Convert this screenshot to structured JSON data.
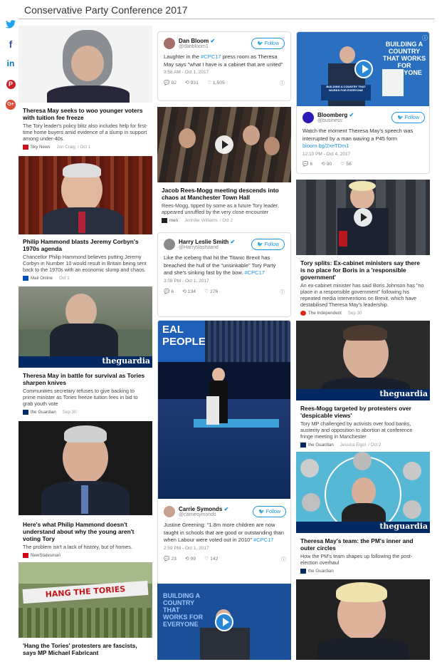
{
  "page": {
    "title": "Conservative Party Conference 2017"
  },
  "social": [
    {
      "name": "twitter",
      "glyph": "🐦"
    },
    {
      "name": "facebook",
      "glyph": "f"
    },
    {
      "name": "linkedin",
      "glyph": "in"
    },
    {
      "name": "pinterest",
      "glyph": "P"
    },
    {
      "name": "google-plus",
      "glyph": "G+"
    }
  ],
  "col1": [
    {
      "headline": "Theresa May seeks to woo younger voters with tuition fee freeze",
      "summary": "The Tory leader's policy blitz also includes help for first-time home buyers amid evidence of a slump in support among under-40s.",
      "source": "Sky News",
      "author": "Jon Craig",
      "date": "/ Oct 1"
    },
    {
      "headline": "Philip Hammond blasts Jeremy Corbyn's 1970s agenda",
      "summary": "Chancellor Philip Hammond believes putting Jeremy Corbyn in Number 10 would result in Britain being sent back to the 1970s with an economic slump and chaos.",
      "source": "Mail Online",
      "date": "Oct 1"
    },
    {
      "headline": "Theresa May in battle for survival as Tories sharpen knives",
      "summary": "Communities secretary refuses to give backing to prime minister as Tories freeze tuition fees in bid to grab youth vote",
      "source": "the Guardian",
      "date": "Sep 30"
    },
    {
      "headline": "Here's what Philip Hammond doesn't understand about why the young aren't voting Tory",
      "summary": "The problem isn't a lack of history, but of homes.",
      "source": "NewStatesman"
    },
    {
      "headline": "'Hang the Tories' protesters are fascists, says MP Michael Fabricant",
      "banner": "HANG THE TORIES"
    }
  ],
  "col2": {
    "tweet1": {
      "name": "Dan Bloom",
      "handle": "@danbloom1",
      "follow": "Follow",
      "text_pre": "Laughter in the ",
      "tag": "#CPC17",
      "text_post": " press room as Theresa May says \"what I have is a cabinet that are united\"",
      "time": "9:58 AM - Oct 1, 2017",
      "replies": "92",
      "retweets": "931",
      "likes": "1,505"
    },
    "article": {
      "headline": "Jacob Rees-Mogg meeting descends into chaos at Manchester Town Hall",
      "summary": "Rees-Mogg, tipped by some as a future Tory leader, appeared unruffled by the very close encounter",
      "source": "men",
      "author": "Jennifer Williams",
      "date": "/ Oct 2"
    },
    "tweet2": {
      "name": "Harry Leslie Smith",
      "handle": "@Harryslaststand",
      "follow": "Follow",
      "text_pre": "Like the iceberg that hit the Titanic Brexit has breached the hull of the \"unsinkable\" Tory Party and she's sinking fast by the bow. ",
      "tag": "#CPC17",
      "text_post": "",
      "time": "3:08 PM - Oct 1, 2017",
      "replies": "6",
      "retweets": "134",
      "likes": "276"
    },
    "stage_image": {
      "line1": "EAL",
      "line2": "PEOPLE"
    },
    "tweet3": {
      "name": "Carrie Symonds",
      "handle": "@carriesymonds",
      "follow": "Follow",
      "text_pre": "Justine Greening: \"1.8m more children are now taught in schools that are good or outstanding than when Labour were voted out in 2010\" ",
      "tag": "#CPC17",
      "text_post": "",
      "time": "2:59 PM - Oct 1, 2017",
      "replies": "23",
      "retweets": "99",
      "likes": "142"
    },
    "video": {
      "slogan": "BUILDING A COUNTRY THAT WORKS FOR EVERYONE"
    }
  },
  "col3": {
    "video_top": {
      "slogan": "BUILDING A COUNTRY THAT WORKS FOR EVERYONE",
      "lectern": "BUILDING A COUNTRY THAT WORKS FOR EVERYONE"
    },
    "tweet": {
      "name": "Bloomberg",
      "handle": "@business",
      "follow": "Follow",
      "text": "Watch the moment Theresa May's speech was interrupted by a man waving a P45 form",
      "link": "bloom.bg/2xeTDm1",
      "time": "12:10 PM - Oct 4, 2017",
      "replies": "6",
      "retweets": "90",
      "likes": "56"
    },
    "a1": {
      "headline": "Tory splits: Ex-cabinet ministers say there is no place for Boris in a 'responsible government'",
      "summary": "An ex-cabinet minister has said Boris Johnson has \"no place in a responsible government\" following his repeated media interventions on Brexit, which have destabilised Theresa May's leadership.",
      "source": "The Independent",
      "date": "Sep 30"
    },
    "a2": {
      "headline": "Rees-Mogg targeted by protesters over 'despicable views'",
      "summary": "Tory MP challenged by activists over food banks, austerity and opposition to abortion at conference fringe meeting in Manchester",
      "source": "the Guardian",
      "author": "Jessica Elgot",
      "date": "/ Oct 2"
    },
    "a3": {
      "headline": "Theresa May's team: the PM's inner and outer circles",
      "summary": "How the PM's team shapes up following the post-election overhaul",
      "source": "the Guardian"
    },
    "watermark": "theguardia"
  },
  "colors": {
    "twitter_blue": "#1b95e0",
    "tory_blue": "#0d6db5",
    "guardian_blue": "#052962"
  }
}
